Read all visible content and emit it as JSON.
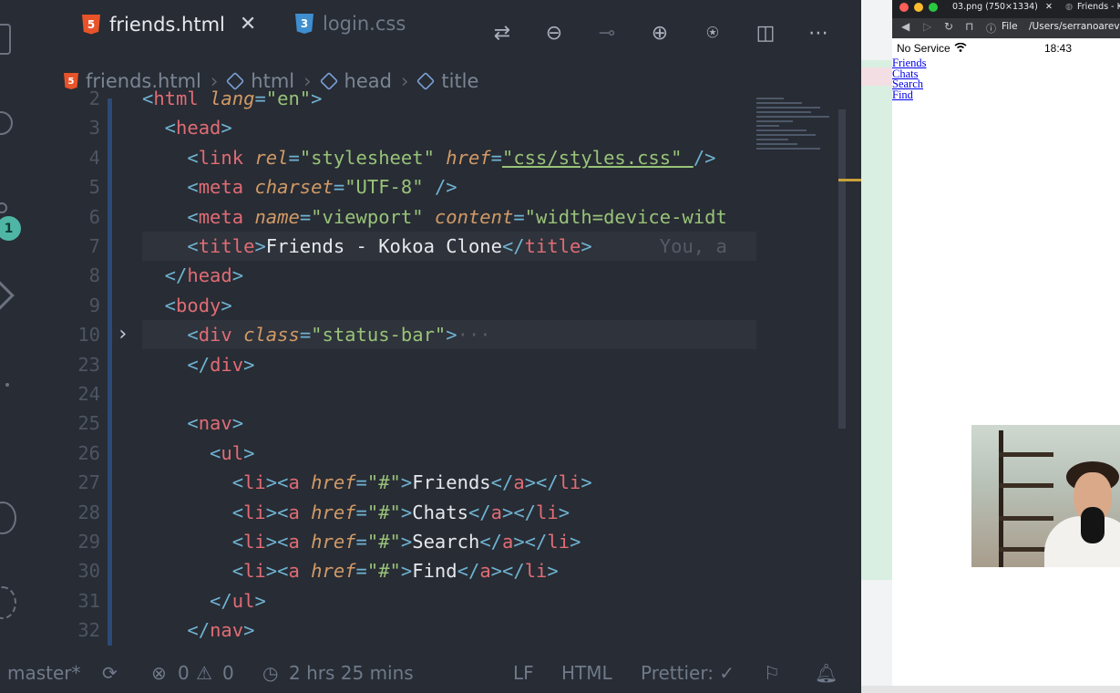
{
  "editor": {
    "tabs": [
      {
        "label": "friends.html",
        "active": true
      },
      {
        "label": "login.css",
        "active": false
      }
    ],
    "breadcrumb": [
      "friends.html",
      "html",
      "head",
      "title"
    ],
    "source_control_badge": "1",
    "lines": [
      {
        "n": "2",
        "segs": [
          [
            "t-pun",
            "<"
          ],
          [
            "t-tag",
            "html "
          ],
          [
            "t-attr",
            "lang"
          ],
          [
            "t-pun",
            "="
          ],
          [
            "t-str",
            "\"en\""
          ],
          [
            "t-pun",
            ">"
          ]
        ]
      },
      {
        "n": "3",
        "segs": [
          [
            "t-pun",
            "  <"
          ],
          [
            "t-tag",
            "head"
          ],
          [
            "t-pun",
            ">"
          ]
        ]
      },
      {
        "n": "4",
        "segs": [
          [
            "t-pun",
            "    <"
          ],
          [
            "t-tag",
            "link "
          ],
          [
            "t-attr",
            "rel"
          ],
          [
            "t-pun",
            "="
          ],
          [
            "t-str",
            "\"stylesheet\" "
          ],
          [
            "t-attr",
            "href"
          ],
          [
            "t-pun",
            "="
          ],
          [
            "t-str",
            "\"css/styles.css\" "
          ],
          [
            "t-pun",
            "/>"
          ]
        ]
      },
      {
        "n": "5",
        "segs": [
          [
            "t-pun",
            "    <"
          ],
          [
            "t-tag",
            "meta "
          ],
          [
            "t-attr",
            "charset"
          ],
          [
            "t-pun",
            "="
          ],
          [
            "t-str",
            "\"UTF-8\" "
          ],
          [
            "t-pun",
            "/>"
          ]
        ]
      },
      {
        "n": "6",
        "segs": [
          [
            "t-pun",
            "    <"
          ],
          [
            "t-tag",
            "meta "
          ],
          [
            "t-attr",
            "name"
          ],
          [
            "t-pun",
            "="
          ],
          [
            "t-str",
            "\"viewport\" "
          ],
          [
            "t-attr",
            "content"
          ],
          [
            "t-pun",
            "="
          ],
          [
            "t-str",
            "\"width=device-widt"
          ]
        ]
      },
      {
        "n": "7",
        "segs": [
          [
            "t-pun",
            "    <"
          ],
          [
            "t-tag",
            "title"
          ],
          [
            "t-pun",
            ">"
          ],
          [
            "t-txt",
            "Friends - Kokoa Clone"
          ],
          [
            "t-pun",
            "</"
          ],
          [
            "t-tag",
            "title"
          ],
          [
            "t-pun",
            ">"
          ],
          [
            "t-cmt",
            "      You, a"
          ]
        ],
        "hl": true
      },
      {
        "n": "8",
        "segs": [
          [
            "t-pun",
            "  </"
          ],
          [
            "t-tag",
            "head"
          ],
          [
            "t-pun",
            ">"
          ]
        ]
      },
      {
        "n": "9",
        "segs": [
          [
            "t-pun",
            "  <"
          ],
          [
            "t-tag",
            "body"
          ],
          [
            "t-pun",
            ">"
          ]
        ]
      },
      {
        "n": "10",
        "segs": [
          [
            "t-pun",
            "    <"
          ],
          [
            "t-tag",
            "div "
          ],
          [
            "t-attr",
            "class"
          ],
          [
            "t-pun",
            "="
          ],
          [
            "t-str",
            "\"status-bar\""
          ],
          [
            "t-pun",
            ">"
          ],
          [
            "t-cmt",
            "···"
          ]
        ],
        "hl": true,
        "fold": true
      },
      {
        "n": "23",
        "segs": [
          [
            "t-pun",
            "    </"
          ],
          [
            "t-tag",
            "div"
          ],
          [
            "t-pun",
            ">"
          ]
        ]
      },
      {
        "n": "24",
        "segs": []
      },
      {
        "n": "25",
        "segs": [
          [
            "t-pun",
            "    <"
          ],
          [
            "t-tag",
            "nav"
          ],
          [
            "t-pun",
            ">"
          ]
        ]
      },
      {
        "n": "26",
        "segs": [
          [
            "t-pun",
            "      <"
          ],
          [
            "t-tag",
            "ul"
          ],
          [
            "t-pun",
            ">"
          ]
        ]
      },
      {
        "n": "27",
        "segs": [
          [
            "t-pun",
            "        <"
          ],
          [
            "t-tag",
            "li"
          ],
          [
            "t-pun",
            "><"
          ],
          [
            "t-tag",
            "a "
          ],
          [
            "t-attr",
            "href"
          ],
          [
            "t-pun",
            "="
          ],
          [
            "t-str",
            "\"#\""
          ],
          [
            "t-pun",
            ">"
          ],
          [
            "t-txt",
            "Friends"
          ],
          [
            "t-pun",
            "</"
          ],
          [
            "t-tag",
            "a"
          ],
          [
            "t-pun",
            "></"
          ],
          [
            "t-tag",
            "li"
          ],
          [
            "t-pun",
            ">"
          ]
        ]
      },
      {
        "n": "28",
        "segs": [
          [
            "t-pun",
            "        <"
          ],
          [
            "t-tag",
            "li"
          ],
          [
            "t-pun",
            "><"
          ],
          [
            "t-tag",
            "a "
          ],
          [
            "t-attr",
            "href"
          ],
          [
            "t-pun",
            "="
          ],
          [
            "t-str",
            "\"#\""
          ],
          [
            "t-pun",
            ">"
          ],
          [
            "t-txt",
            "Chats"
          ],
          [
            "t-pun",
            "</"
          ],
          [
            "t-tag",
            "a"
          ],
          [
            "t-pun",
            "></"
          ],
          [
            "t-tag",
            "li"
          ],
          [
            "t-pun",
            ">"
          ]
        ]
      },
      {
        "n": "29",
        "segs": [
          [
            "t-pun",
            "        <"
          ],
          [
            "t-tag",
            "li"
          ],
          [
            "t-pun",
            "><"
          ],
          [
            "t-tag",
            "a "
          ],
          [
            "t-attr",
            "href"
          ],
          [
            "t-pun",
            "="
          ],
          [
            "t-str",
            "\"#\""
          ],
          [
            "t-pun",
            ">"
          ],
          [
            "t-txt",
            "Search"
          ],
          [
            "t-pun",
            "</"
          ],
          [
            "t-tag",
            "a"
          ],
          [
            "t-pun",
            "></"
          ],
          [
            "t-tag",
            "li"
          ],
          [
            "t-pun",
            ">"
          ]
        ]
      },
      {
        "n": "30",
        "segs": [
          [
            "t-pun",
            "        <"
          ],
          [
            "t-tag",
            "li"
          ],
          [
            "t-pun",
            "><"
          ],
          [
            "t-tag",
            "a "
          ],
          [
            "t-attr",
            "href"
          ],
          [
            "t-pun",
            "="
          ],
          [
            "t-str",
            "\"#\""
          ],
          [
            "t-pun",
            ">"
          ],
          [
            "t-txt",
            "Find"
          ],
          [
            "t-pun",
            "</"
          ],
          [
            "t-tag",
            "a"
          ],
          [
            "t-pun",
            "></"
          ],
          [
            "t-tag",
            "li"
          ],
          [
            "t-pun",
            ">"
          ]
        ]
      },
      {
        "n": "31",
        "segs": [
          [
            "t-pun",
            "      </"
          ],
          [
            "t-tag",
            "ul"
          ],
          [
            "t-pun",
            ">"
          ]
        ]
      },
      {
        "n": "32",
        "segs": [
          [
            "t-pun",
            "    </"
          ],
          [
            "t-tag",
            "nav"
          ],
          [
            "t-pun",
            ">"
          ]
        ]
      }
    ]
  },
  "statusbar": {
    "branch": "master*",
    "errors": "0",
    "warnings": "0",
    "time": "2 hrs 25 mins",
    "eol": "LF",
    "language": "HTML",
    "prettier": "Prettier: ✓"
  },
  "browser": {
    "tab1": "03.png (750×1334)",
    "tab2": "Friends - Ko",
    "file_label": "File",
    "url": "/Users/serranoareva",
    "status_service": "No Service",
    "status_time": "18:43",
    "links": [
      "Friends",
      "Chats",
      "Search",
      "Find"
    ]
  },
  "colors": {
    "editor_bg": "#282c34",
    "tag": "#e06c75",
    "attr": "#d19a66",
    "string": "#98c379",
    "link": "#0000ee"
  }
}
